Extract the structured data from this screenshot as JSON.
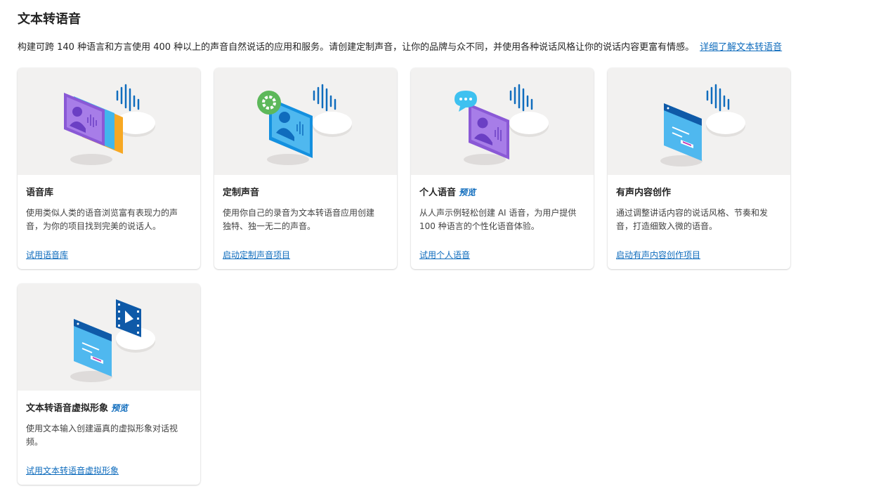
{
  "header": {
    "title": "文本转语音",
    "description": "构建可跨 140 种语言和方言使用 400 种以上的声音自然说话的应用和服务。请创建定制声音，让你的品牌与众不同，并使用各种说话风格让你的说话内容更富有情感。",
    "learn_more_link": "详细了解文本转语音"
  },
  "cards": [
    {
      "title": "语音库",
      "badge": "",
      "description": "使用类似人类的语音浏览富有表现力的声音，为你的项目找到完美的说话人。",
      "action": "试用语音库",
      "icon": "voice-gallery-illustration"
    },
    {
      "title": "定制声音",
      "badge": "",
      "description": "使用你自己的录音为文本转语音应用创建独特、独一无二的声音。",
      "action": "启动定制声音项目",
      "icon": "custom-voice-illustration"
    },
    {
      "title": "个人语音",
      "badge": "预览",
      "description": "从人声示例轻松创建 AI 语音，为用户提供 100 种语言的个性化语音体验。",
      "action": "试用个人语音",
      "icon": "personal-voice-illustration"
    },
    {
      "title": "有声内容创作",
      "badge": "",
      "description": "通过调整讲话内容的说话风格、节奏和发音，打造细致入微的语音。",
      "action": "启动有声内容创作项目",
      "icon": "audio-content-creation-illustration"
    },
    {
      "title": "文本转语音虚拟形象",
      "badge": "预览",
      "description": "使用文本输入创建逼真的虚拟形象对话视频。",
      "action": "试用文本转语音虚拟形象",
      "icon": "avatar-video-illustration"
    }
  ]
}
